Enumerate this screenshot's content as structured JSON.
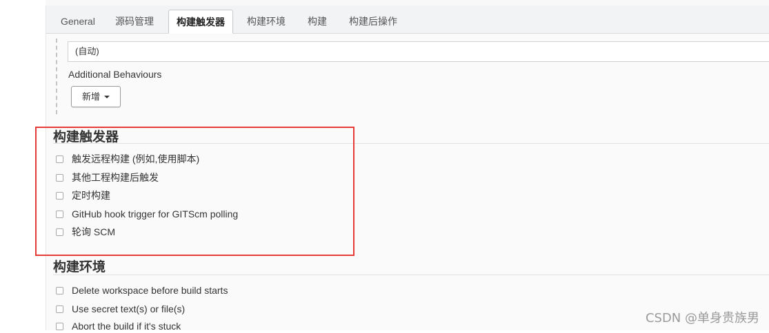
{
  "tabs": [
    {
      "label": "General"
    },
    {
      "label": "源码管理"
    },
    {
      "label": "构建触发器",
      "active": true
    },
    {
      "label": "构建环境"
    },
    {
      "label": "构建"
    },
    {
      "label": "构建后操作"
    }
  ],
  "scm": {
    "auto_value": "(自动)",
    "additional_behaviours_label": "Additional Behaviours",
    "add_button_label": "新增"
  },
  "build_triggers": {
    "title": "构建触发器",
    "options": [
      {
        "label": "触发远程构建 (例如,使用脚本)",
        "checked": false
      },
      {
        "label": "其他工程构建后触发",
        "checked": false
      },
      {
        "label": "定时构建",
        "checked": false
      },
      {
        "label": "GitHub hook trigger for GITScm polling",
        "checked": false
      },
      {
        "label": "轮询 SCM",
        "checked": false
      }
    ]
  },
  "build_env": {
    "title": "构建环境",
    "options": [
      {
        "label": "Delete workspace before build starts",
        "checked": false
      },
      {
        "label": "Use secret text(s) or file(s)",
        "checked": false
      },
      {
        "label": "Abort the build if it's stuck",
        "checked": false
      }
    ]
  },
  "watermark": "CSDN @单身贵族男",
  "colors": {
    "highlight": "#e53935",
    "panel_bg": "#fafafa",
    "tabbar_bg": "#f2f3f5"
  }
}
